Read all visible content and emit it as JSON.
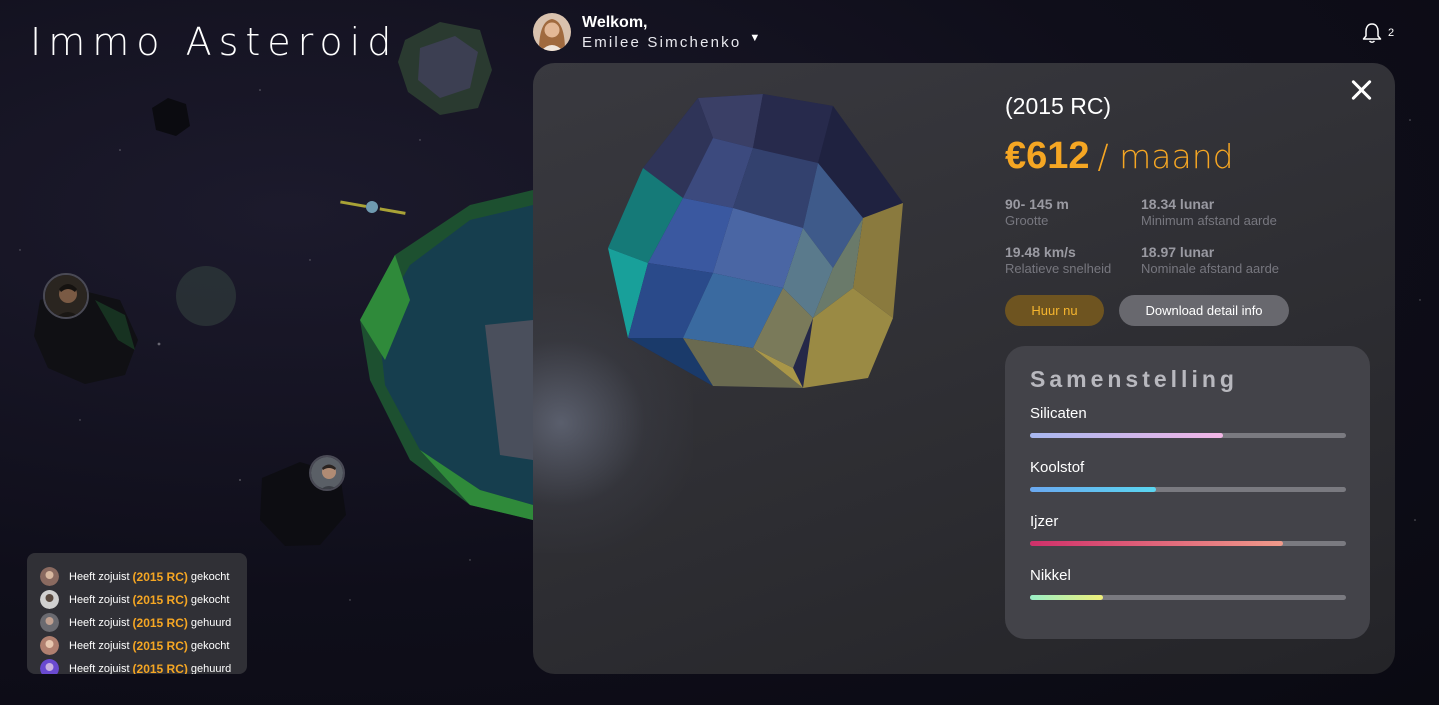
{
  "app": {
    "title": "Immo Asteroid"
  },
  "header": {
    "greeting": "Welkom,",
    "user_name": "Emilee Simchenko",
    "notifications_count": "2"
  },
  "detail": {
    "title": "(2015 RC)",
    "price": "€612",
    "price_unit": "/ maand",
    "stats": [
      {
        "value": "90- 145 m",
        "label": "Grootte"
      },
      {
        "value": "18.34 lunar",
        "label": "Minimum afstand aarde"
      },
      {
        "value": "19.48 km/s",
        "label": "Relatieve snelheid"
      },
      {
        "value": "18.97 lunar",
        "label": "Nominale afstand aarde"
      }
    ],
    "rent_button": "Huur nu",
    "download_button": "Download detail info",
    "composition": {
      "heading": "Samenstelling",
      "items": [
        {
          "label": "Silicaten",
          "fraction": 0.61
        },
        {
          "label": "Koolstof",
          "fraction": 0.4
        },
        {
          "label": "Ijzer",
          "fraction": 0.8
        },
        {
          "label": "Nikkel",
          "fraction": 0.23
        }
      ]
    }
  },
  "feed": [
    {
      "prefix": "Heeft zojuist",
      "asteroid": "(2015 RC)",
      "action": "gekocht"
    },
    {
      "prefix": "Heeft zojuist",
      "asteroid": "(2015 RC)",
      "action": "gekocht"
    },
    {
      "prefix": "Heeft zojuist",
      "asteroid": "(2015 RC)",
      "action": "gehuurd"
    },
    {
      "prefix": "Heeft zojuist",
      "asteroid": "(2015 RC)",
      "action": "gekocht"
    },
    {
      "prefix": "Heeft zojuist",
      "asteroid": "(2015 RC)",
      "action": "gehuurd"
    }
  ],
  "colors": {
    "accent": "#f5a623",
    "panel": "#333338"
  }
}
